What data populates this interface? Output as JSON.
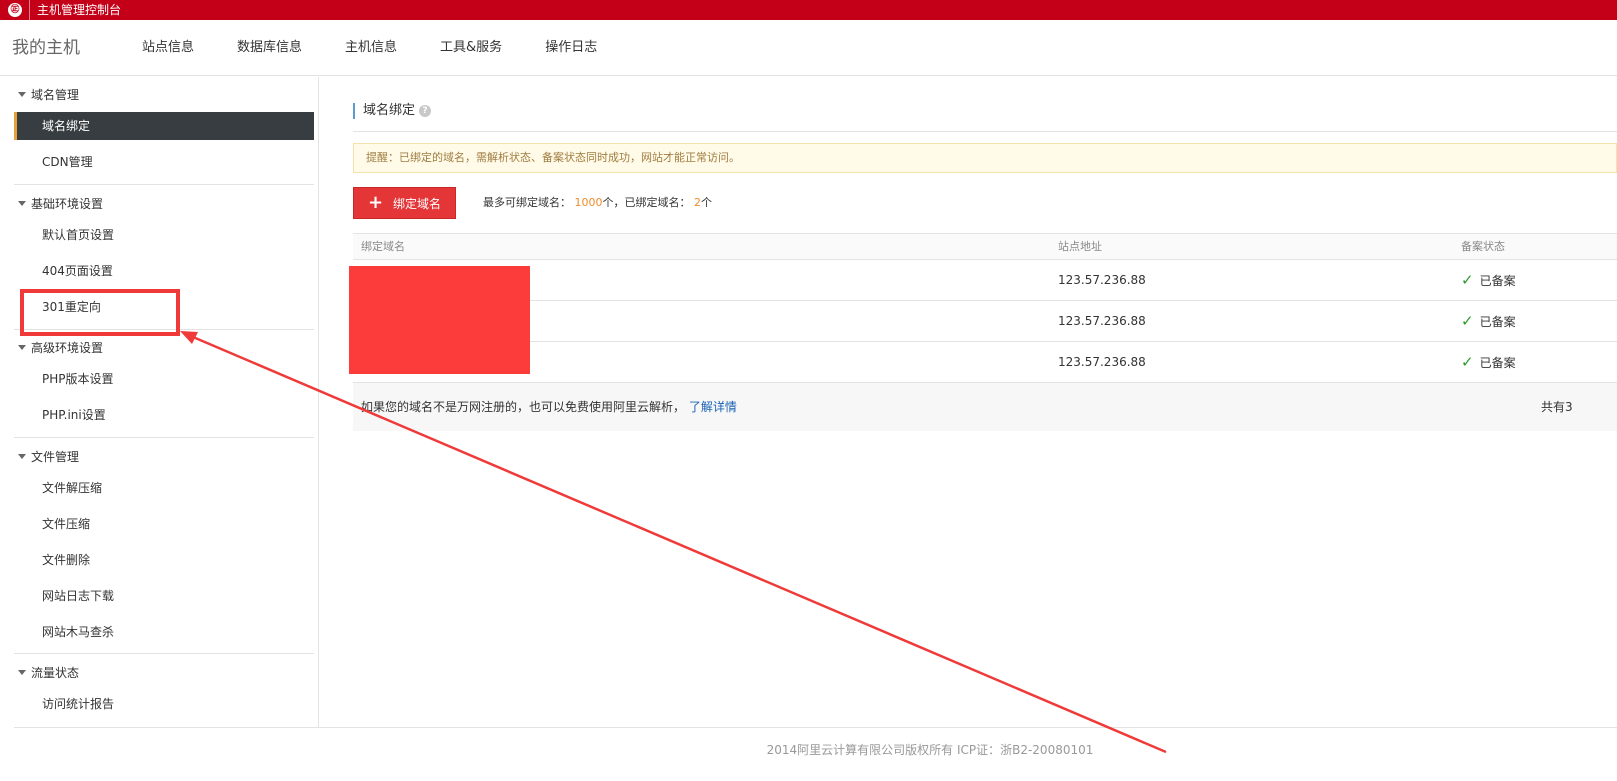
{
  "topbar": {
    "logo_glyph": "㊣",
    "title": "主机管理控制台"
  },
  "header": {
    "brand": "我的主机",
    "nav": [
      "站点信息",
      "数据库信息",
      "主机信息",
      "工具&服务",
      "操作日志"
    ]
  },
  "sidebar": {
    "groups": [
      {
        "title": "域名管理",
        "items": [
          "域名绑定",
          "CDN管理"
        ]
      },
      {
        "title": "基础环境设置",
        "items": [
          "默认首页设置",
          "404页面设置",
          "301重定向"
        ]
      },
      {
        "title": "高级环境设置",
        "items": [
          "PHP版本设置",
          "PHP.ini设置"
        ]
      },
      {
        "title": "文件管理",
        "items": [
          "文件解压缩",
          "文件压缩",
          "文件删除",
          "网站日志下载",
          "网站木马查杀"
        ]
      },
      {
        "title": "流量状态",
        "items": [
          "访问统计报告"
        ]
      }
    ],
    "active_item": "域名绑定"
  },
  "main": {
    "section_title": "域名绑定",
    "help_glyph": "?",
    "notice": "提醒：已绑定的域名，需解析状态、备案状态同时成功，网站才能正常访问。",
    "add_button": {
      "plus": "+",
      "label": "绑定域名"
    },
    "quota": {
      "max_label": "最多可绑定域名：",
      "max_value": "1000",
      "max_unit": "个，",
      "bound_label": "已绑定域名：",
      "bound_value": "2",
      "bound_unit": "个"
    },
    "table": {
      "columns": [
        "绑定域名",
        "站点地址",
        "备案状态"
      ],
      "rows": [
        {
          "domain": "",
          "address": "123.57.236.88",
          "status": "已备案"
        },
        {
          "domain": "",
          "address": "123.57.236.88",
          "status": "已备案"
        },
        {
          "domain": "",
          "address": "123.57.236.88",
          "status": "已备案"
        }
      ],
      "check_glyph": "✓",
      "footer_text": "如果您的域名不是万网注册的，也可以免费使用阿里云解析，",
      "footer_link": "了解详情",
      "footer_total": "共有3"
    }
  },
  "footer": "2014阿里云计算有限公司版权所有 ICP证：浙B2-20080101",
  "annotation_color": "#f03a3a",
  "colors": {
    "brand_red": "#c40018",
    "button_red": "#e43537",
    "sidebar_active": "#373d41",
    "link": "#1a62b4",
    "quota_num": "#f08c2b",
    "check": "#2c9a2c"
  },
  "icons": {
    "caret": "caret-down-icon",
    "help": "help-icon",
    "check": "check-icon",
    "plus": "plus-icon",
    "logo": "logo-icon"
  }
}
